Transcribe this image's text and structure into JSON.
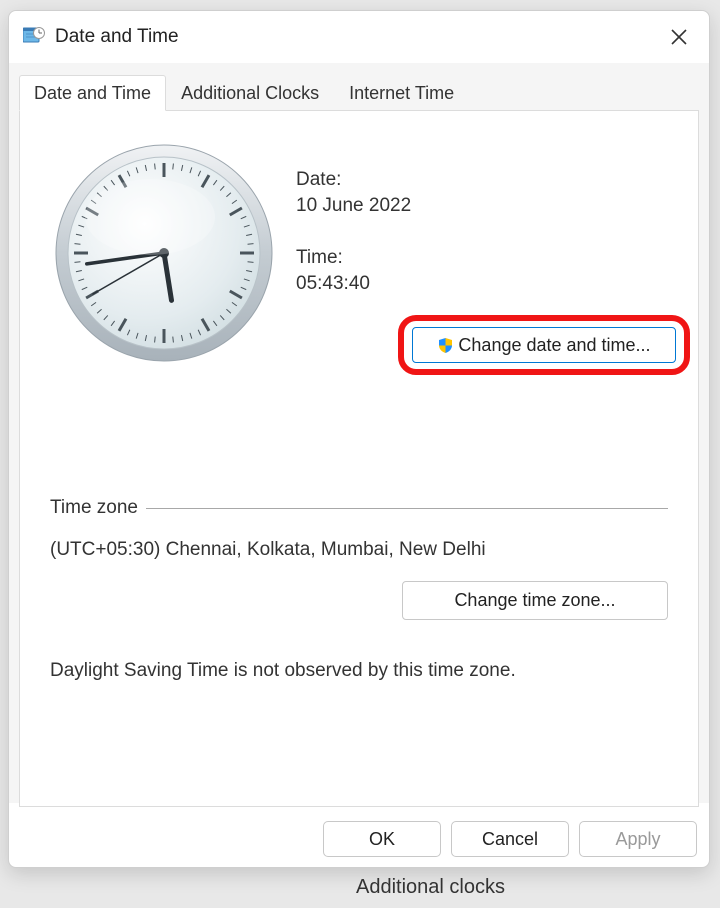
{
  "window": {
    "title": "Date and Time"
  },
  "tabs": {
    "date_time": "Date and Time",
    "additional_clocks": "Additional Clocks",
    "internet_time": "Internet Time"
  },
  "panel": {
    "date_label": "Date:",
    "date_value": "10 June 2022",
    "time_label": "Time:",
    "time_value": "05:43:40",
    "change_datetime": "Change date and time...",
    "timezone_section": "Time zone",
    "timezone_value": "(UTC+05:30) Chennai, Kolkata, Mumbai, New Delhi",
    "change_timezone": "Change time zone...",
    "dst_note": "Daylight Saving Time is not observed by this time zone."
  },
  "buttons": {
    "ok": "OK",
    "cancel": "Cancel",
    "apply": "Apply"
  },
  "background": {
    "additional_clocks_link": "Additional clocks"
  },
  "clock": {
    "hour_hand_angle": 171,
    "minute_hand_angle": 262,
    "second_hand_angle": 240
  }
}
